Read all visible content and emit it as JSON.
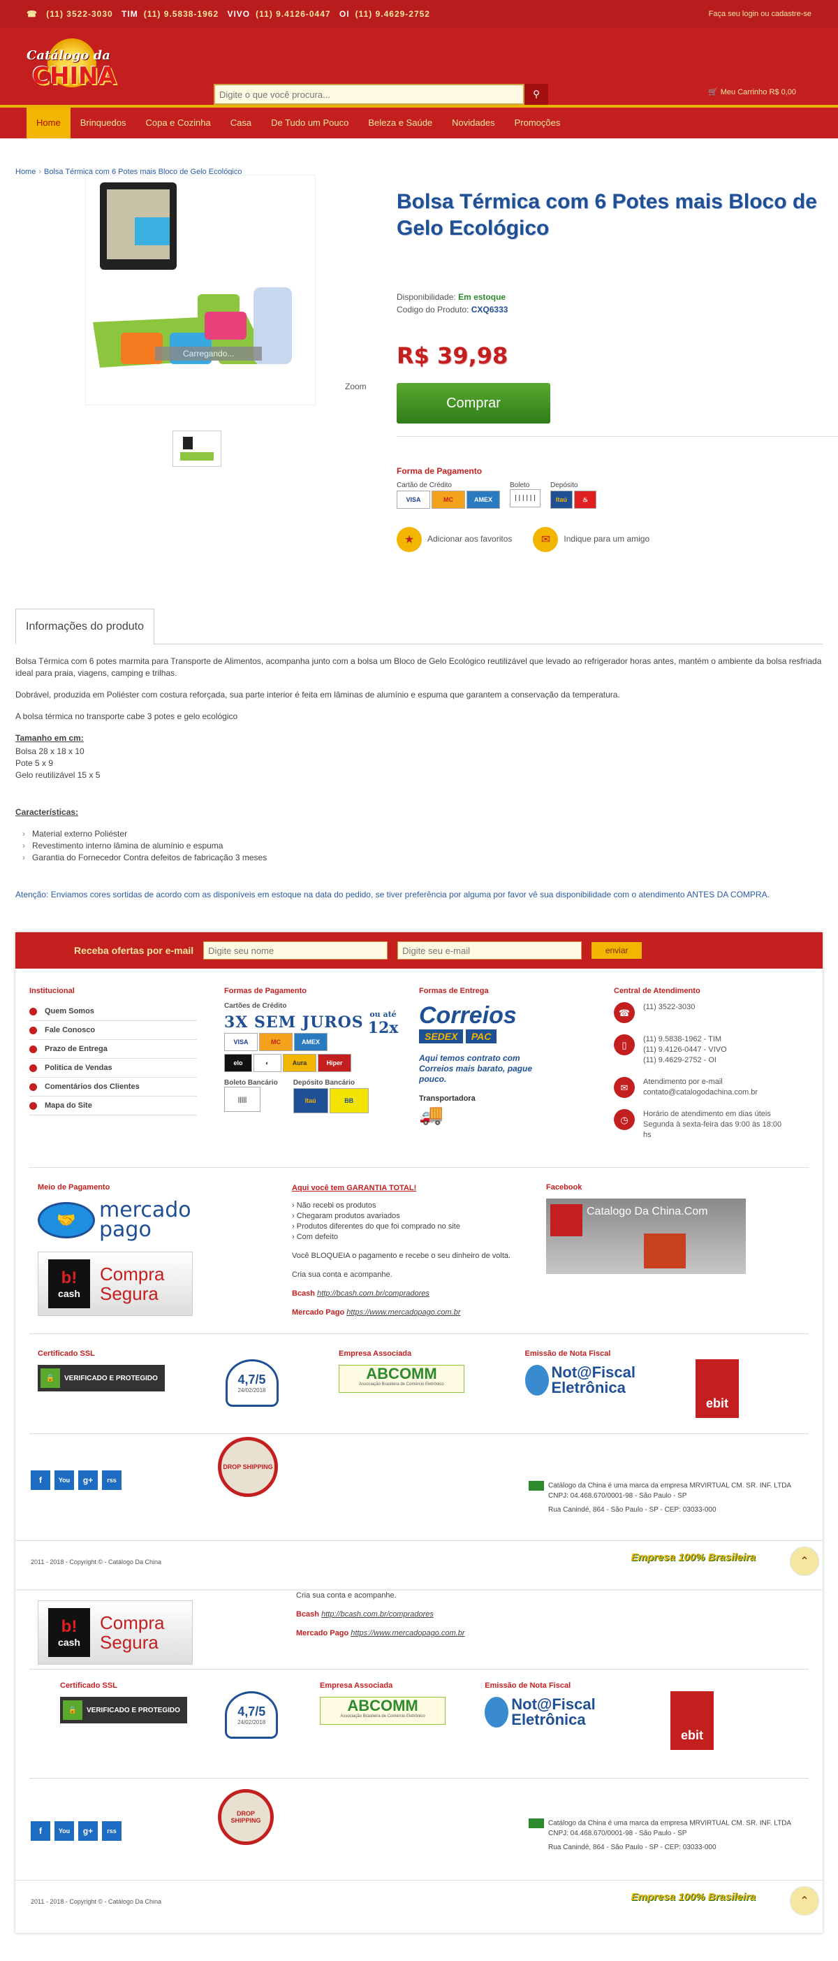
{
  "topbar": {
    "phones": [
      {
        "op": "",
        "num": "(11) 3522-3030"
      },
      {
        "op": "TIM",
        "num": "(11) 9.5838-1962"
      },
      {
        "op": "VIVO",
        "num": "(11) 9.4126-0447"
      },
      {
        "op": "OI",
        "num": "(11) 9.4629-2752"
      }
    ],
    "login": "Faça seu login ou cadastre-se"
  },
  "header": {
    "logo_top": "Catálogo da",
    "logo_main": "CHINA",
    "search_placeholder": "Digite o que você procura...",
    "cart": "Meu Carrinho R$ 0,00"
  },
  "nav": [
    "Home",
    "Brinquedos",
    "Copa e Cozinha",
    "Casa",
    "De Tudo um Pouco",
    "Beleza e Saúde",
    "Novidades",
    "Promoções"
  ],
  "breadcrumb": {
    "home": "Home",
    "current": "Bolsa Térmica com 6 Potes mais Bloco de Gelo Ecológico"
  },
  "product": {
    "title": "Bolsa Térmica com 6 Potes mais Bloco de Gelo Ecológico",
    "avail_label": "Disponibilidade:",
    "avail_value": "Em estoque",
    "code_label": "Codigo do Produto:",
    "code_value": "CXQ6333",
    "price": "R$ 39,98",
    "buy": "Comprar",
    "loading": "Carregando...",
    "zoom": "Zoom",
    "pay_title": "Forma de Pagamento",
    "pay_credit": "Cartão de Crédito",
    "pay_boleto": "Boleto",
    "pay_deposito": "Depósito",
    "fav": "Adicionar aos favoritos",
    "friend": "Indique para um amigo"
  },
  "tab": "Informações do produto",
  "desc": {
    "p1": "Bolsa Térmica com 6 potes marmita para Transporte de Alimentos, acompanha junto com a bolsa um Bloco de Gelo Ecológico reutilizável que levado ao refrigerador horas antes, mantém o ambiente da bolsa resfriada ideal para praia, viagens, camping e trilhas.",
    "p2": "Dobrável, produzida em Poliéster com costura reforçada, sua parte interior é feita em lâminas de alumínio e espuma que garantem a conservação da temperatura.",
    "p3": "A bolsa térmica no transporte cabe 3 potes e gelo ecológico",
    "size_h": "Tamanho em cm:",
    "sizes": [
      "Bolsa 28 x 18 x 10",
      "Pote 5 x 9",
      "Gelo reutilizável 15 x 5"
    ],
    "feat_h": "Características:",
    "feats": [
      "Material externo Poliéster",
      "Revestimento interno lâmina de alumínio e espuma",
      "Garantia do Fornecedor Contra defeitos de fabricação 3 meses"
    ],
    "note": "Atenção: Enviamos cores sortidas de acordo com as disponíveis em estoque na data do pedido, se tiver preferência por alguma por favor vê sua disponibilidade com o atendimento ANTES DA COMPRA."
  },
  "footer": {
    "news_label": "Receba ofertas por e-mail",
    "name_ph": "Digite seu nome",
    "email_ph": "Digite seu e-mail",
    "send": "enviar",
    "inst_h": "Institucional",
    "inst": [
      "Quem Somos",
      "Fale Conosco",
      "Prazo de Entrega",
      "Politica de Vendas",
      "Comentários dos Clientes",
      "Mapa do Site"
    ],
    "pay_h": "Formas de Pagamento",
    "cards_h": "Cartões de Crédito",
    "juros": "3X SEM JUROS",
    "ouate": "ou até",
    "x12": "12x",
    "boleto_h": "Boleto Bancário",
    "dep_h": "Depósito Bancário",
    "ent_h": "Formas de Entrega",
    "correios": "Correios",
    "sedex": "SEDEX",
    "pac": "PAC",
    "ent_text": "Aqui temos contrato com Correios mais barato, pague pouco.",
    "transp": "Transportadora",
    "at_h": "Central de Atendimento",
    "at_phone": "(11) 3522-3030",
    "at_cells": [
      "(11) 9.5838-1962 - TIM",
      "(11) 9.4126-0447 - VIVO",
      "(11) 9.4629-2752 - OI"
    ],
    "at_email_l": "Atendimento por e-mail",
    "at_email": "contato@catalogodachina.com.br",
    "at_hours": "Horário de atendimento em dias úteis Segunda à sexta-feira das 9:00 às 18:00 hs",
    "mp_h": "Meio de Pagamento",
    "mp_name": "mercado pago",
    "bcash_name": "Compra Segura",
    "gar_h": "Aqui você tem GARANTIA TOTAL!",
    "gar": [
      "Não recebi os produtos",
      "Chegaram produtos avariados",
      "Produtos diferentes do que foi comprado no site",
      "Com defeito"
    ],
    "gar_p1": "Você BLOQUEIA o pagamento e recebe o seu dinheiro de volta.",
    "gar_p2": "Cria sua conta e acompanhe.",
    "bcash_l": "Bcash",
    "bcash_u": "http://bcash.com.br/compradores",
    "mp_l": "Mercado Pago",
    "mp_u": "https://www.mercadopago.com.br",
    "fb_h": "Facebook",
    "fb_name": "Catalogo Da China.Com",
    "ssl_h": "Certificado SSL",
    "ssl": "VERIFICADO E PROTEGIDO",
    "rating": "4,7/5",
    "rating_date": "24/02/2018",
    "assoc_h": "Empresa Associada",
    "abcomm": "ABCOMM",
    "abcomm_sub": "Associação Brasileira de Comércio Eletrônico",
    "nf_h": "Emissão de Nota Fiscal",
    "nf": "Not@Fiscal Eletrônica",
    "ebit": "ebit",
    "company1": "Catálogo da China é uma marca da empresa MRVIRTUAL CM. SR. INF. LTDA",
    "company2": "CNPJ: 04.468.670/0001-98 - São Paulo - SP",
    "address": "Rua Canindé, 864 - São Paulo - SP - CEP: 03033-000",
    "copyright": "2011 - 2018 - Copyright © - Catálogo Da China",
    "brasil": "Empresa 100% Brasileira",
    "social": [
      "f",
      "You",
      "g+",
      "rss"
    ],
    "drop": "DROP SHIPPING"
  }
}
